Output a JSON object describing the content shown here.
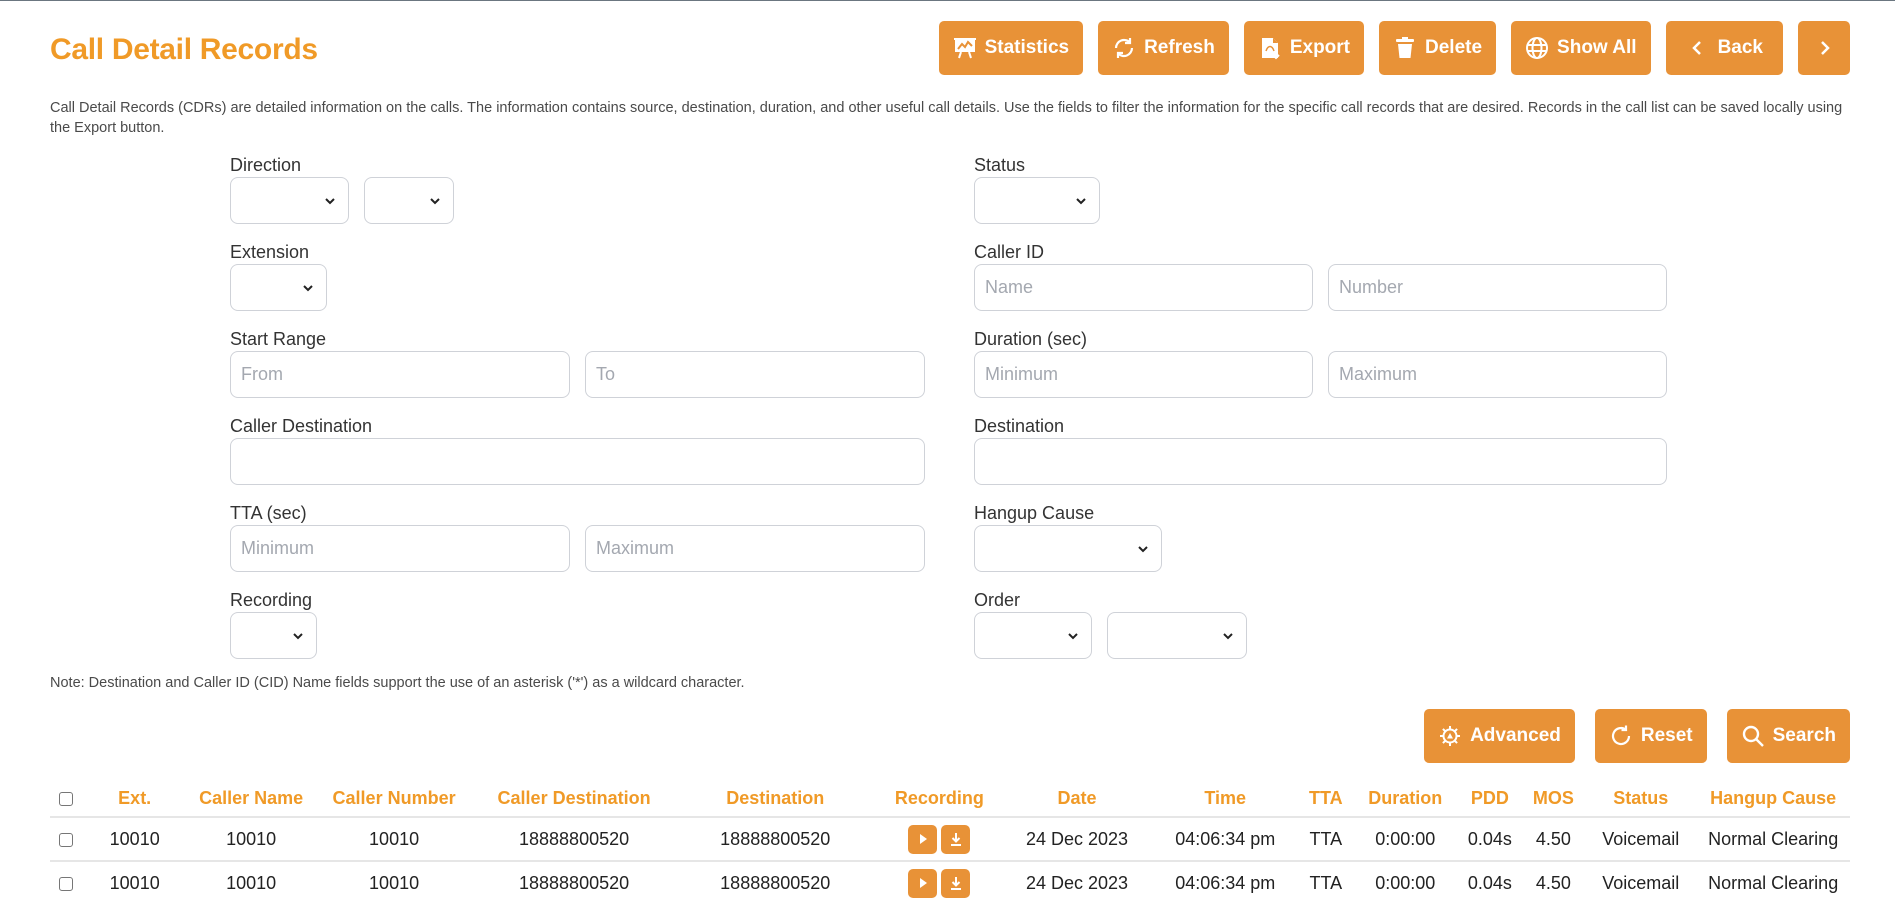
{
  "header": {
    "title": "Call Detail Records",
    "description": "Call Detail Records (CDRs) are detailed information on the calls. The information contains source, destination, duration, and other useful call details. Use the fields to filter the information for the specific call records that are desired. Records in the call list can be saved locally using the Export button."
  },
  "toolbar": {
    "statistics": {
      "label": "Statistics",
      "icon": "presentation-chart-icon"
    },
    "refresh": {
      "label": "Refresh",
      "icon": "refresh-icon"
    },
    "export": {
      "label": "Export",
      "icon": "file-export-icon"
    },
    "delete": {
      "label": "Delete",
      "icon": "trash-icon"
    },
    "show_all": {
      "label": "Show All",
      "icon": "globe-icon"
    },
    "back": {
      "label": "Back",
      "icon": "chevron-left-icon"
    },
    "next": {
      "label": "",
      "icon": "chevron-right-icon"
    }
  },
  "form": {
    "direction": {
      "label": "Direction",
      "value1": "",
      "value2": ""
    },
    "status": {
      "label": "Status",
      "value": ""
    },
    "extension": {
      "label": "Extension",
      "value": ""
    },
    "caller_id": {
      "label": "Caller ID",
      "name_placeholder": "Name",
      "number_placeholder": "Number",
      "name_value": "",
      "number_value": ""
    },
    "start_range": {
      "label": "Start Range",
      "from_placeholder": "From",
      "to_placeholder": "To"
    },
    "duration": {
      "label": "Duration (sec)",
      "min_placeholder": "Minimum",
      "max_placeholder": "Maximum"
    },
    "caller_destination": {
      "label": "Caller Destination",
      "value": ""
    },
    "destination": {
      "label": "Destination",
      "value": ""
    },
    "tta": {
      "label": "TTA (sec)",
      "min_placeholder": "Minimum",
      "max_placeholder": "Maximum"
    },
    "hangup_cause": {
      "label": "Hangup Cause",
      "value": ""
    },
    "recording": {
      "label": "Recording",
      "value": ""
    },
    "order": {
      "label": "Order",
      "value1": "",
      "value2": ""
    }
  },
  "note": "Note: Destination and Caller ID (CID) Name fields support the use of an asterisk ('*') as a wildcard character.",
  "actions": {
    "advanced": {
      "label": "Advanced",
      "icon": "gear-icon"
    },
    "reset": {
      "label": "Reset",
      "icon": "reset-icon"
    },
    "search": {
      "label": "Search",
      "icon": "search-icon"
    }
  },
  "table": {
    "columns": [
      "Ext.",
      "Caller Name",
      "Caller Number",
      "Caller Destination",
      "Destination",
      "Recording",
      "Date",
      "Time",
      "TTA",
      "Duration",
      "PDD",
      "MOS",
      "Status",
      "Hangup Cause"
    ],
    "rows": [
      {
        "ext": "10010",
        "caller_name": "10010",
        "caller_number": "10010",
        "caller_destination": "18888800520",
        "destination": "18888800520",
        "date": "24 Dec 2023",
        "time": "04:06:34 pm",
        "tta": "TTA",
        "duration": "0:00:00",
        "pdd": "0.04s",
        "mos": "4.50",
        "status": "Voicemail",
        "hangup_cause": "Normal Clearing"
      },
      {
        "ext": "10010",
        "caller_name": "10010",
        "caller_number": "10010",
        "caller_destination": "18888800520",
        "destination": "18888800520",
        "date": "24 Dec 2023",
        "time": "04:06:34 pm",
        "tta": "TTA",
        "duration": "0:00:00",
        "pdd": "0.04s",
        "mos": "4.50",
        "status": "Voicemail",
        "hangup_cause": "Normal Clearing"
      }
    ]
  },
  "colors": {
    "accent": "#f09a27",
    "button": "#e89237",
    "border": "#cfd2d8"
  }
}
